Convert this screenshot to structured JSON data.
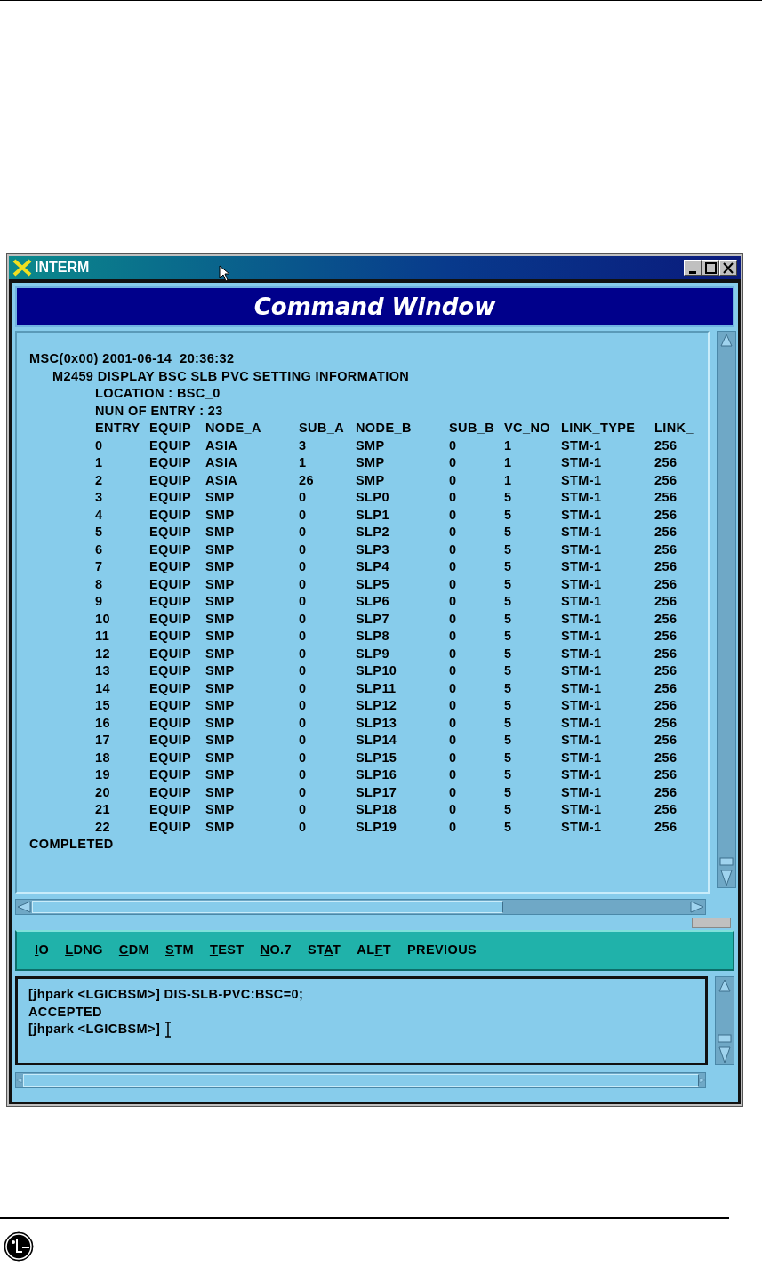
{
  "window": {
    "title": "INTERM"
  },
  "banner": {
    "title": "Command Window"
  },
  "output": {
    "lines": [
      {
        "kind": "stamp",
        "text": "MSC(0x00) 2001-06-14  20:36:32"
      },
      {
        "kind": "title",
        "text": "M2459 DISPLAY BSC SLB PVC SETTING INFORMATION"
      },
      {
        "kind": "field",
        "text": "LOCATION : BSC_0"
      },
      {
        "kind": "field",
        "text": "NUN OF ENTRY : 23"
      }
    ],
    "table": {
      "columns": [
        "ENTRY",
        "EQUIP",
        "NODE_A",
        "SUB_A",
        "NODE_B",
        "SUB_B",
        "VC_NO",
        "LINK_TYPE",
        "LINK_"
      ],
      "rows": [
        [
          "0",
          "EQUIP",
          "ASIA",
          "3",
          "SMP",
          "0",
          "1",
          "STM-1",
          "256"
        ],
        [
          "1",
          "EQUIP",
          "ASIA",
          "1",
          "SMP",
          "0",
          "1",
          "STM-1",
          "256"
        ],
        [
          "2",
          "EQUIP",
          "ASIA",
          "26",
          "SMP",
          "0",
          "1",
          "STM-1",
          "256"
        ],
        [
          "3",
          "EQUIP",
          "SMP",
          "0",
          "SLP0",
          "0",
          "5",
          "STM-1",
          "256"
        ],
        [
          "4",
          "EQUIP",
          "SMP",
          "0",
          "SLP1",
          "0",
          "5",
          "STM-1",
          "256"
        ],
        [
          "5",
          "EQUIP",
          "SMP",
          "0",
          "SLP2",
          "0",
          "5",
          "STM-1",
          "256"
        ],
        [
          "6",
          "EQUIP",
          "SMP",
          "0",
          "SLP3",
          "0",
          "5",
          "STM-1",
          "256"
        ],
        [
          "7",
          "EQUIP",
          "SMP",
          "0",
          "SLP4",
          "0",
          "5",
          "STM-1",
          "256"
        ],
        [
          "8",
          "EQUIP",
          "SMP",
          "0",
          "SLP5",
          "0",
          "5",
          "STM-1",
          "256"
        ],
        [
          "9",
          "EQUIP",
          "SMP",
          "0",
          "SLP6",
          "0",
          "5",
          "STM-1",
          "256"
        ],
        [
          "10",
          "EQUIP",
          "SMP",
          "0",
          "SLP7",
          "0",
          "5",
          "STM-1",
          "256"
        ],
        [
          "11",
          "EQUIP",
          "SMP",
          "0",
          "SLP8",
          "0",
          "5",
          "STM-1",
          "256"
        ],
        [
          "12",
          "EQUIP",
          "SMP",
          "0",
          "SLP9",
          "0",
          "5",
          "STM-1",
          "256"
        ],
        [
          "13",
          "EQUIP",
          "SMP",
          "0",
          "SLP10",
          "0",
          "5",
          "STM-1",
          "256"
        ],
        [
          "14",
          "EQUIP",
          "SMP",
          "0",
          "SLP11",
          "0",
          "5",
          "STM-1",
          "256"
        ],
        [
          "15",
          "EQUIP",
          "SMP",
          "0",
          "SLP12",
          "0",
          "5",
          "STM-1",
          "256"
        ],
        [
          "16",
          "EQUIP",
          "SMP",
          "0",
          "SLP13",
          "0",
          "5",
          "STM-1",
          "256"
        ],
        [
          "17",
          "EQUIP",
          "SMP",
          "0",
          "SLP14",
          "0",
          "5",
          "STM-1",
          "256"
        ],
        [
          "18",
          "EQUIP",
          "SMP",
          "0",
          "SLP15",
          "0",
          "5",
          "STM-1",
          "256"
        ],
        [
          "19",
          "EQUIP",
          "SMP",
          "0",
          "SLP16",
          "0",
          "5",
          "STM-1",
          "256"
        ],
        [
          "20",
          "EQUIP",
          "SMP",
          "0",
          "SLP17",
          "0",
          "5",
          "STM-1",
          "256"
        ],
        [
          "21",
          "EQUIP",
          "SMP",
          "0",
          "SLP18",
          "0",
          "5",
          "STM-1",
          "256"
        ],
        [
          "22",
          "EQUIP",
          "SMP",
          "0",
          "SLP19",
          "0",
          "5",
          "STM-1",
          "256"
        ]
      ]
    },
    "footer": "COMPLETED"
  },
  "menu": [
    {
      "key": "I",
      "after": "O"
    },
    {
      "key": "L",
      "after": "DNG"
    },
    {
      "key": "C",
      "after": "DM"
    },
    {
      "key": "S",
      "after": "TM"
    },
    {
      "key": "T",
      "after": "EST"
    },
    {
      "key": "N",
      "after": "O.7"
    },
    {
      "before": "ST",
      "key": "A",
      "after": "T"
    },
    {
      "before": "AL",
      "key": "F",
      "after": "T"
    },
    {
      "text": "PREVIOUS"
    }
  ],
  "console": {
    "lines": [
      "[jhpark <LGICBSM>] DIS-SLB-PVC:BSC=0;",
      "ACCEPTED",
      "[jhpark <LGICBSM>]"
    ]
  }
}
